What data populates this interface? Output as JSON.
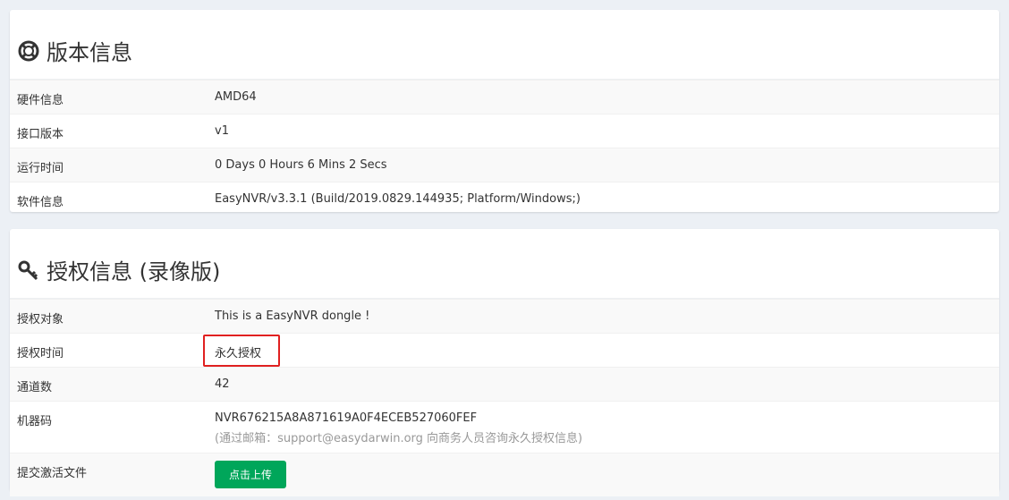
{
  "version_panel": {
    "title": "版本信息",
    "icon": "lifebuoy-icon",
    "rows": [
      {
        "label": "硬件信息",
        "value": "AMD64"
      },
      {
        "label": "接口版本",
        "value": "v1"
      },
      {
        "label": "运行时间",
        "value": "0 Days 0 Hours 6 Mins 2 Secs"
      },
      {
        "label": "软件信息",
        "value": "EasyNVR/v3.3.1 (Build/2019.0829.144935; Platform/Windows;)"
      }
    ]
  },
  "license_panel": {
    "title": "授权信息 (录像版)",
    "icon": "key-icon",
    "rows": [
      {
        "label": "授权对象",
        "value": "This is a EasyNVR dongle !"
      },
      {
        "label": "授权时间",
        "value": "永久授权"
      },
      {
        "label": "通道数",
        "value": "42"
      },
      {
        "label": "机器码",
        "value": "NVR676215A8A871619A0F4ECEB527060FEF",
        "note": "(通过邮箱：support@easydarwin.org 向商务人员咨询永久授权信息)"
      },
      {
        "label": "提交激活文件",
        "button": "点击上传"
      }
    ]
  },
  "colors": {
    "background": "#ecf0f5",
    "upload_button": "#00a65a",
    "highlight_border": "#e02020"
  }
}
